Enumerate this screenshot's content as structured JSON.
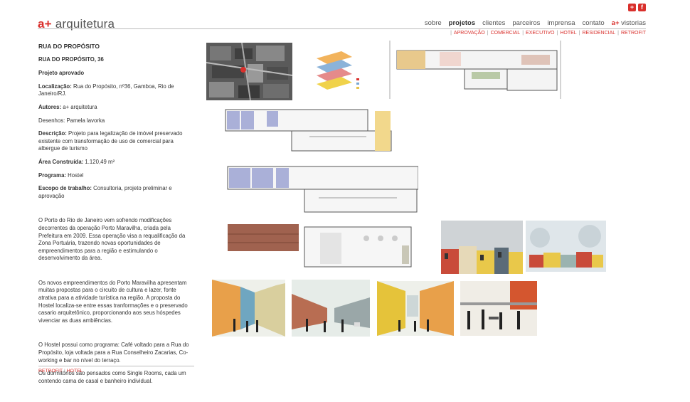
{
  "social": {
    "plus_icon": "+",
    "facebook_icon": "f"
  },
  "logo": {
    "brand": "a+",
    "name": " arquitetura"
  },
  "nav": {
    "items": [
      "sobre",
      "projetos",
      "clientes",
      "parceiros",
      "imprensa",
      "contato"
    ],
    "vistorias_brand": "a+",
    "vistorias_label": " vistorias"
  },
  "subnav": [
    "APROVAÇÃO",
    "COMERCIAL",
    "EXECUTIVO",
    "HOTEL",
    "RESIDENCIAL",
    "RETROFIT"
  ],
  "project": {
    "title": "RUA DO PROPÓSITO",
    "subtitle": "RUA DO PROPÓSITO, 36",
    "status": "Projeto aprovado",
    "loc_label": "Localização:",
    "loc_value": " Rua do Propósito, nº36, Gamboa, Rio de Janeiro/RJ.",
    "authors_label": "Autores:",
    "authors_value": " a+ arquitetura",
    "drawings": "Desenhos: Pamela lavorka",
    "desc_label": "Descrição:",
    "desc_value": " Projeto para legalização de imóvel preservado existente com transformação de uso de comercial para albergue de turismo",
    "area_label": "Área Construída:",
    "area_value": " 1.120,49 m²",
    "program_label": "Programa:",
    "program_value": "  Hostel",
    "scope_label": "Escopo de trabalho:",
    "scope_value": " Consultoria, projeto preliminar e aprovação",
    "para1": "O Porto do Rio de Janeiro vem sofrendo modificações decorrentes da operação Porto Maravilha, criada pela Prefeitura em 2009. Essa operação visa a requalificação da Zona Portuária, trazendo novas oportunidades de empreendimentos para a região e estimulando o desenvolvimento da área.",
    "para2": "Os novos empreendimentos do Porto Maravilha apresentam muitas propostas para o circuito de cultura e lazer, fonte atrativa para a atividade turística na região. A proposta do Hostel localiza-se entre essas tranformações e o preservado casario arquitetônico, proporcionando aos seus hóspedes vivenciar as duas ambiências.",
    "para3": "O Hostel possui como programa: Café voltado para a Rua do Propósito, loja voltada para a Rua Conselheiro Zacarias, Co-working e bar no nível do terraço.",
    "para4": "Os dormitórios são pensados como Single Rooms, cada um contendo cama de casal e banheiro individual."
  },
  "tags": [
    "RETROFIT",
    "HOTEL"
  ]
}
